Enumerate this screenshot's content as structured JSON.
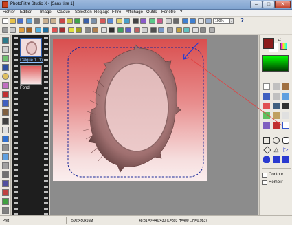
{
  "window": {
    "title": "PhotoFiltre Studio X - [Sans titre 1]",
    "minimize": "–",
    "maximize": "□",
    "close": "✕"
  },
  "menu": [
    "Fichier",
    "Edition",
    "Image",
    "Calque",
    "Sélection",
    "Réglage",
    "Filtre",
    "Affichage",
    "Outils",
    "Fenêtre",
    "?"
  ],
  "toolbar": {
    "zoom": "100%",
    "zoom_arrow": "▾",
    "help": "?"
  },
  "layers": [
    {
      "label": "Calque 1 (1)",
      "selected": true
    },
    {
      "label": "Fond",
      "selected": false
    }
  ],
  "colors": {
    "foreground": "#8b1b1b",
    "background": "#ffffff",
    "swap": "⇄"
  },
  "options": {
    "contour": "Contour",
    "remplir": "Remplir"
  },
  "status": {
    "state": "Prêt",
    "size": "500x450x16M",
    "coords": "48;31 => 440;430 (L=393  H=400  L/H=0,983)"
  }
}
